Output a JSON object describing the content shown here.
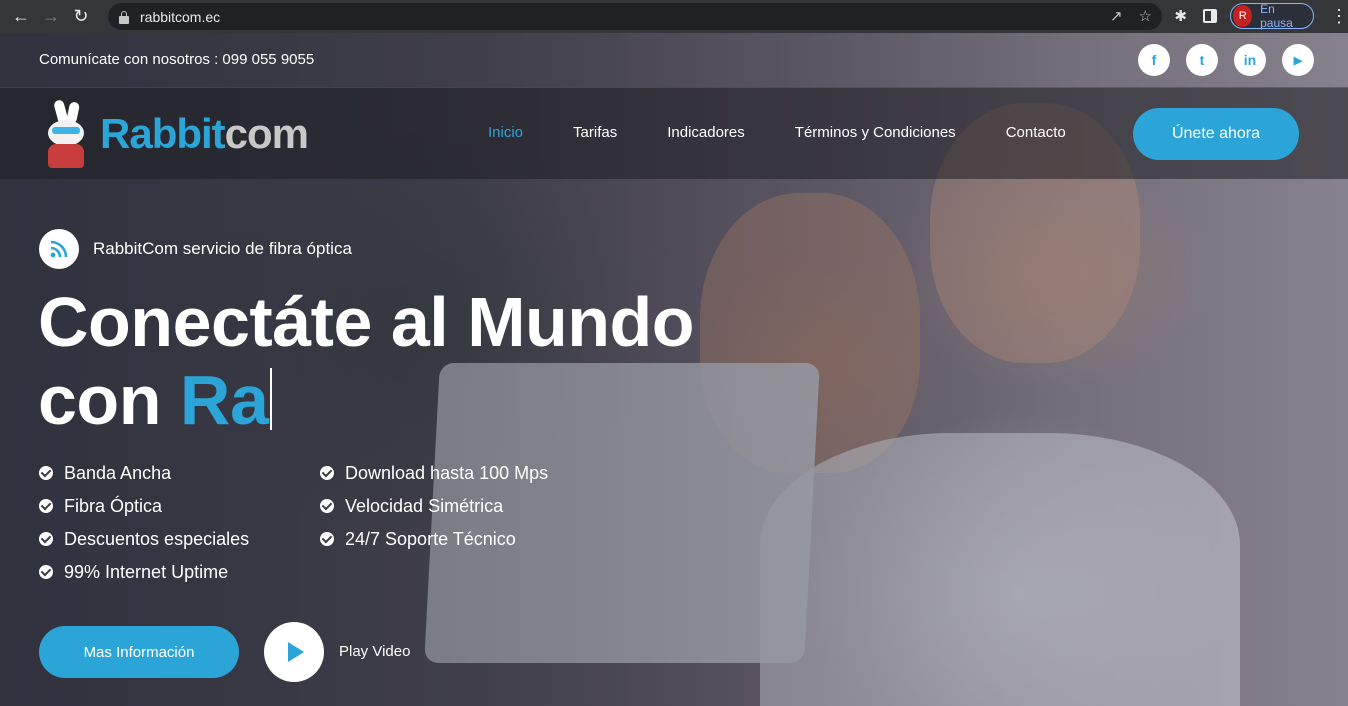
{
  "browser": {
    "url": "rabbitcom.ec",
    "profile_initial": "R",
    "profile_status": "En pausa"
  },
  "topbar": {
    "contact": "Comunícate con nosotros : 099 055 9055",
    "socials": [
      "f",
      "t",
      "in",
      "▶"
    ]
  },
  "logo": {
    "part1": "Rabbit",
    "part2": "com"
  },
  "nav": {
    "items": [
      "Inicio",
      "Tarifas",
      "Indicadores",
      "Términos y Condiciones",
      "Contacto"
    ],
    "cta": "Únete ahora"
  },
  "hero": {
    "tagline": "RabbitCom servicio de fibra óptica",
    "headline_line1": "Conectáte al Mundo",
    "headline_line2_prefix": "con ",
    "headline_accent": "Ra",
    "features_left": [
      "Banda Ancha",
      "Fibra Óptica",
      "Descuentos especiales",
      "99% Internet Uptime"
    ],
    "features_right": [
      "Download hasta 100 Mps",
      "Velocidad Simétrica",
      "24/7 Soporte Técnico"
    ],
    "more_button": "Mas Información",
    "play_label": "Play Video"
  },
  "colors": {
    "accent": "#2ba4d8"
  }
}
